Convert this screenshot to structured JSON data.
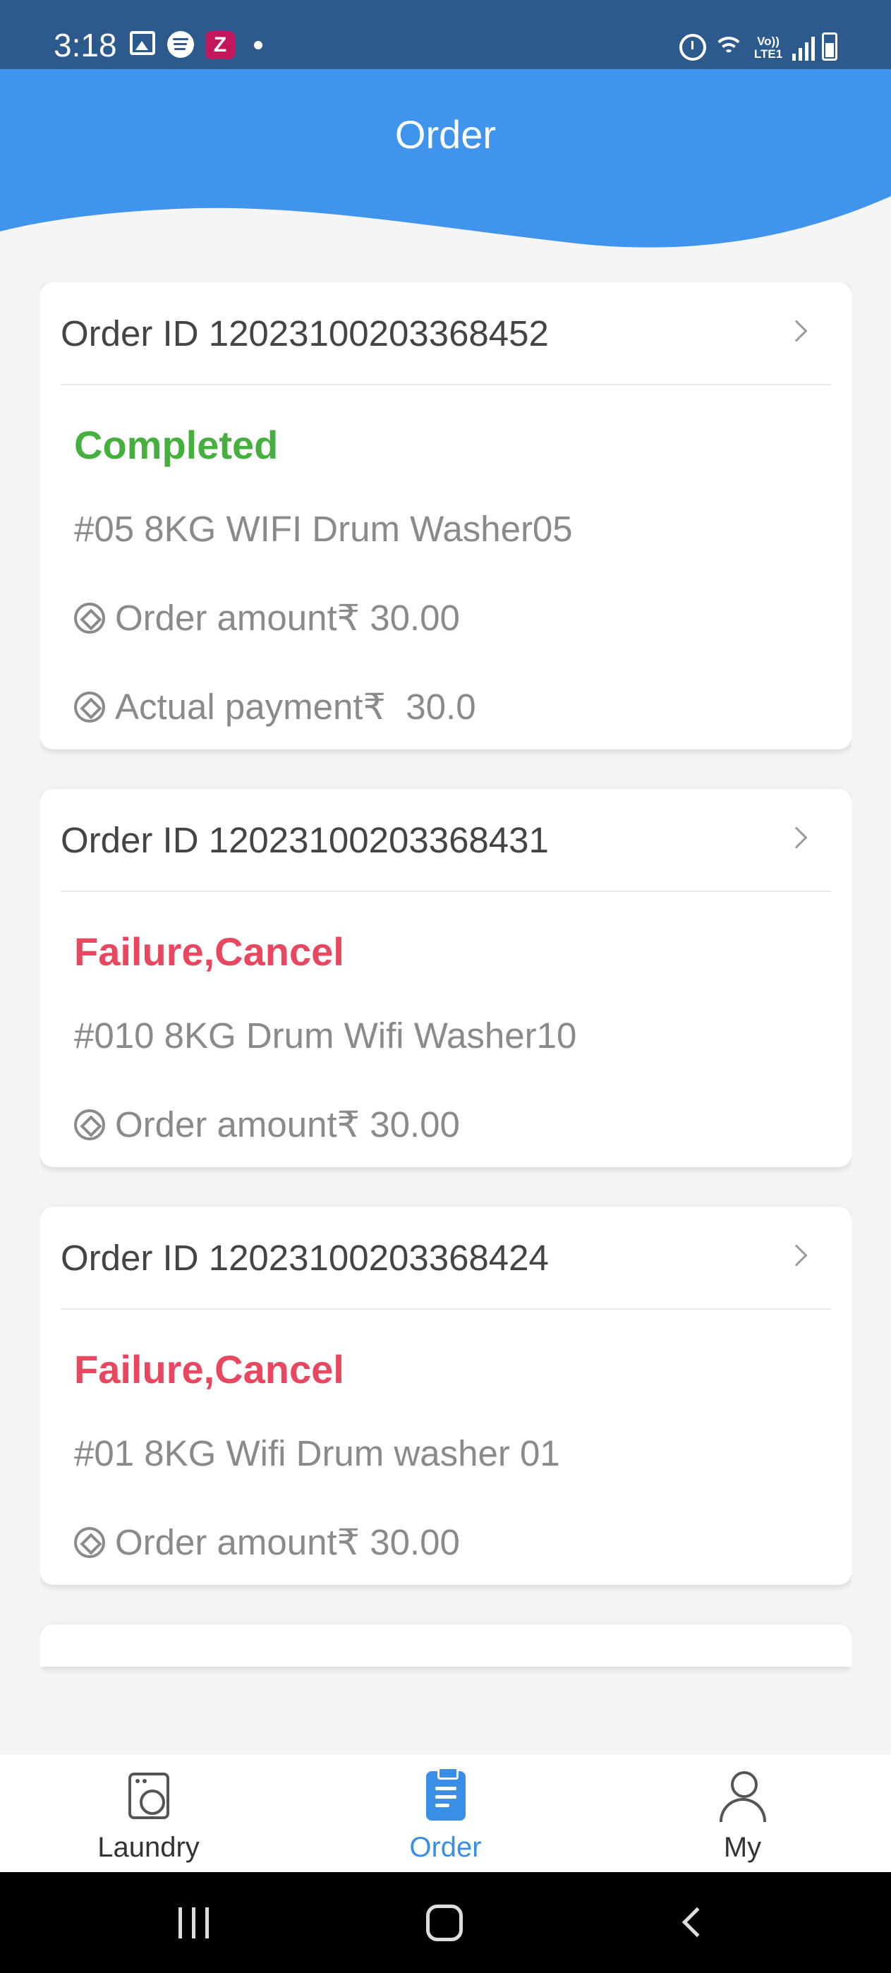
{
  "status_bar": {
    "time": "3:18",
    "network_label": "Vo)) LTE1",
    "icons": [
      "gallery-icon",
      "spotify-icon",
      "zomato-icon",
      "notification-dot-icon",
      "alarm-icon",
      "wifi-icon",
      "volte-icon",
      "signal-icon",
      "battery-icon"
    ]
  },
  "header": {
    "title": "Order",
    "color": "#4194ec"
  },
  "orders": [
    {
      "order_id": "Order ID 12023100203368452",
      "status": "Completed",
      "status_color": "#46b03e",
      "machine": "#05 8KG WIFI Drum Washer05",
      "order_amount": "Order amount₹ 30.00",
      "actual_payment": "Actual payment₹  30.0"
    },
    {
      "order_id": "Order ID 12023100203368431",
      "status": "Failure,Cancel",
      "status_color": "#e9475f",
      "machine": "#010 8KG Drum Wifi Washer10",
      "order_amount": "Order amount₹ 30.00"
    },
    {
      "order_id": "Order ID 12023100203368424",
      "status": "Failure,Cancel",
      "status_color": "#e9475f",
      "machine": "#01 8KG Wifi Drum washer 01",
      "order_amount": "Order amount₹ 30.00"
    }
  ],
  "tab_bar": {
    "tabs": [
      {
        "label": "Laundry",
        "icon": "washing-machine-icon",
        "active": false
      },
      {
        "label": "Order",
        "icon": "clipboard-icon",
        "active": true
      },
      {
        "label": "My",
        "icon": "person-icon",
        "active": false
      }
    ],
    "active_color": "#3a8ee6"
  },
  "nav_bar": {
    "buttons": [
      "recents-icon",
      "home-icon",
      "back-icon"
    ]
  }
}
